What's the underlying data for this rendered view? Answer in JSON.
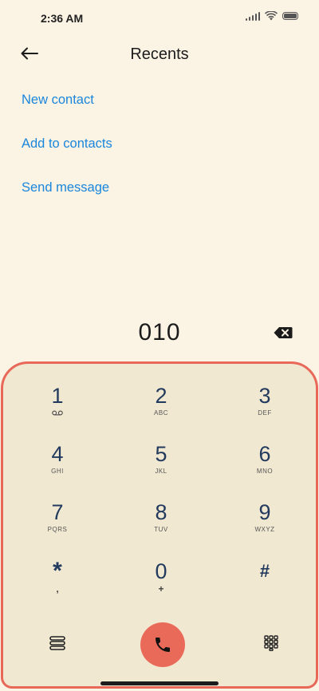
{
  "status_bar": {
    "time": "2:36 AM"
  },
  "header": {
    "title": "Recents"
  },
  "actions": [
    {
      "label": "New contact"
    },
    {
      "label": "Add to contacts"
    },
    {
      "label": "Send message"
    }
  ],
  "dialer": {
    "number": "010"
  },
  "keypad": {
    "keys": [
      {
        "digit": "1",
        "letters": ""
      },
      {
        "digit": "2",
        "letters": "ABC"
      },
      {
        "digit": "3",
        "letters": "DEF"
      },
      {
        "digit": "4",
        "letters": "GHI"
      },
      {
        "digit": "5",
        "letters": "JKL"
      },
      {
        "digit": "6",
        "letters": "MNO"
      },
      {
        "digit": "7",
        "letters": "PQRS"
      },
      {
        "digit": "8",
        "letters": "TUV"
      },
      {
        "digit": "9",
        "letters": "WXYZ"
      },
      {
        "digit": "*",
        "letters": ","
      },
      {
        "digit": "0",
        "letters": "+"
      },
      {
        "digit": "#",
        "letters": ""
      }
    ]
  },
  "colors": {
    "background": "#fbf3e3",
    "accent_link": "#1a86dc",
    "call_button": "#ea6a5a",
    "keypad_border": "#e8685a",
    "digit": "#223a5e"
  },
  "icons": {
    "back": "back-arrow-icon",
    "backspace": "backspace-icon",
    "voicemail": "voicemail-icon",
    "menu": "menu-icon",
    "call": "phone-icon",
    "dialpad": "dialpad-icon"
  }
}
